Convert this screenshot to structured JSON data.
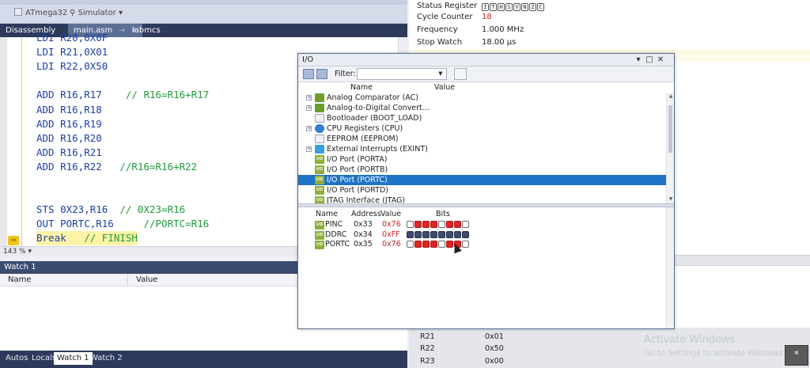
{
  "toolbar": {
    "device": "ATmega32",
    "tool": "Simulator"
  },
  "editor_tabs": [
    {
      "label": "Disassembly"
    },
    {
      "label": "main.asm"
    },
    {
      "label": "labmcs"
    }
  ],
  "code_lines": [
    {
      "code": "LDI R20,0X0F",
      "comment": ""
    },
    {
      "code": "LDI R21,0X01",
      "comment": ""
    },
    {
      "code": "LDI R22,0X50",
      "comment": ""
    },
    {
      "code": "",
      "comment": ""
    },
    {
      "code": "ADD R16,R17    ",
      "comment": "// R16=R16+R17"
    },
    {
      "code": "ADD R16,R18",
      "comment": ""
    },
    {
      "code": "ADD R16,R19",
      "comment": ""
    },
    {
      "code": "ADD R16,R20",
      "comment": ""
    },
    {
      "code": "ADD R16,R21",
      "comment": ""
    },
    {
      "code": "ADD R16,R22   ",
      "comment": "//R16=R16+R22"
    },
    {
      "code": "",
      "comment": ""
    },
    {
      "code": "",
      "comment": ""
    },
    {
      "code": "STS 0X23,R16  ",
      "comment": "// 0X23=R16"
    },
    {
      "code": "OUT PORTC,R16     ",
      "comment": "//PORTC=R16"
    },
    {
      "code": "Break   ",
      "comment": "// FINISH"
    }
  ],
  "zoom": "143 %",
  "watch": {
    "title": "Watch 1",
    "col_name": "Name",
    "col_value": "Value",
    "tabs": [
      "Autos",
      "Locals",
      "Watch 1",
      "Watch 2"
    ]
  },
  "processor": {
    "status_register_label": "Status Register",
    "sreg_bits": [
      "I",
      "T",
      "H",
      "S",
      "V",
      "N",
      "Z",
      "C"
    ],
    "cycle_counter_label": "Cycle Counter",
    "cycle_counter": "18",
    "frequency_label": "Frequency",
    "frequency": "1.000 MHz",
    "stop_watch_label": "Stop Watch",
    "stop_watch": "18.00 µs",
    "registers": [
      {
        "name": "R21",
        "value": "0x01"
      },
      {
        "name": "R22",
        "value": "0x50"
      },
      {
        "name": "R23",
        "value": "0x00"
      }
    ],
    "watermark_title": "Activate Windows",
    "watermark_sub": "Go to Settings to activate Windows."
  },
  "io_window": {
    "title": "I/O",
    "filter_label": "Filter:",
    "filter_value": "",
    "col_name": "Name",
    "col_value": "Value",
    "tree": [
      {
        "label": "Analog Comparator (AC)",
        "icon": "io-module-icon",
        "expandable": true
      },
      {
        "label": "Analog-to-Digital Convert...",
        "icon": "io-module-icon",
        "expandable": true
      },
      {
        "label": "Bootloader (BOOT_LOAD)",
        "icon": "document-icon",
        "expandable": false
      },
      {
        "label": "CPU Registers (CPU)",
        "icon": "globe-icon",
        "expandable": true
      },
      {
        "label": "EEPROM (EEPROM)",
        "icon": "document-icon",
        "expandable": false
      },
      {
        "label": "External Interrupts (EXINT)",
        "icon": "interrupt-icon",
        "expandable": true
      },
      {
        "label": "I/O Port (PORTA)",
        "icon": "io-port-icon",
        "expandable": false
      },
      {
        "label": "I/O Port (PORTB)",
        "icon": "io-port-icon",
        "expandable": false
      },
      {
        "label": "I/O Port (PORTC)",
        "icon": "io-port-icon",
        "expandable": false,
        "selected": true
      },
      {
        "label": "I/O Port (PORTD)",
        "icon": "io-port-icon",
        "expandable": false
      },
      {
        "label": "JTAG Interface (JTAG)",
        "icon": "io-port-icon",
        "expandable": false
      }
    ],
    "bits_header": {
      "name": "Name",
      "address": "Address",
      "value": "Value",
      "bits": "Bits"
    },
    "port_registers": [
      {
        "name": "PINC",
        "address": "0x33",
        "value": "0x76",
        "bits": [
          "off",
          "red",
          "red",
          "red",
          "off",
          "red",
          "red",
          "off"
        ]
      },
      {
        "name": "DDRC",
        "address": "0x34",
        "value": "0xFF",
        "bits": [
          "navy",
          "navy",
          "navy",
          "navy",
          "navy",
          "navy",
          "navy",
          "navy"
        ]
      },
      {
        "name": "PORTC",
        "address": "0x35",
        "value": "0x76",
        "bits": [
          "off",
          "red",
          "red",
          "red",
          "off",
          "red",
          "red",
          "off"
        ]
      }
    ]
  },
  "colors": {
    "selection": "#1f73c7",
    "bit_set": "#e02424",
    "bit_ddr": "#3b4a6b",
    "code_keyword": "#1c3fa6",
    "code_comment": "#1f9b3a"
  }
}
